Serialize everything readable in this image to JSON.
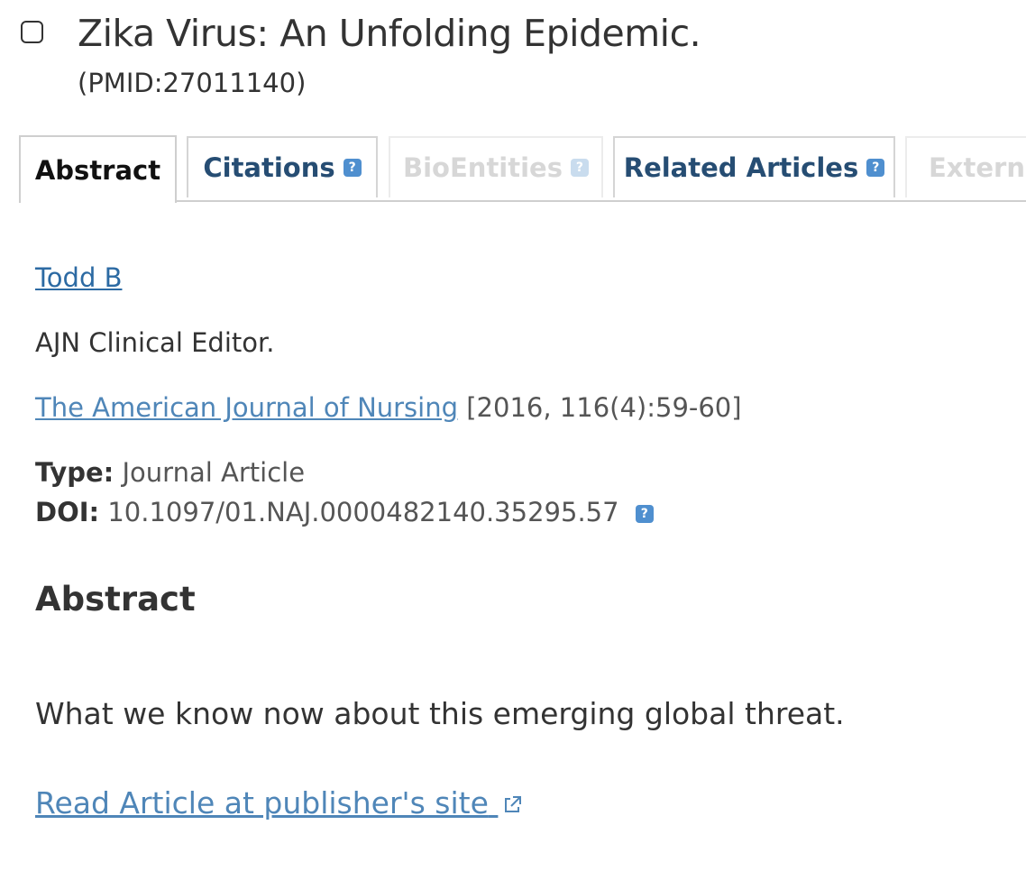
{
  "article": {
    "title": "Zika Virus: An Unfolding Epidemic.",
    "pmid": "(PMID:27011140)"
  },
  "tabs": [
    {
      "label": "Abstract",
      "state": "active"
    },
    {
      "label": "Citations",
      "state": "link",
      "help_icon": "help-icon"
    },
    {
      "label": "BioEntities",
      "state": "disabled",
      "help_icon": "help-icon"
    },
    {
      "label": "Related Articles",
      "state": "link",
      "help_icon": "help-icon"
    },
    {
      "label": "Externa",
      "state": "disabled"
    }
  ],
  "details": {
    "author": "Todd B",
    "affiliation": "AJN Clinical Editor.",
    "journal": "The American Journal of Nursing",
    "citation": "[2016, 116(4):59-60]",
    "type_label": "Type:",
    "type_value": "Journal Article",
    "doi_label": "DOI:",
    "doi_value": "10.1097/01.NAJ.0000482140.35295.57"
  },
  "abstract": {
    "heading": "Abstract",
    "text": "What we know now about this emerging global threat."
  },
  "read_link": {
    "label": "Read Article at publisher's site",
    "icon": "external-link-icon"
  },
  "colors": {
    "link": "#2c6aa3",
    "link_light": "#4f86b8",
    "tab_link": "#264d73",
    "help_badge": "#4f8fcf",
    "disabled": "#d7d7d7"
  }
}
